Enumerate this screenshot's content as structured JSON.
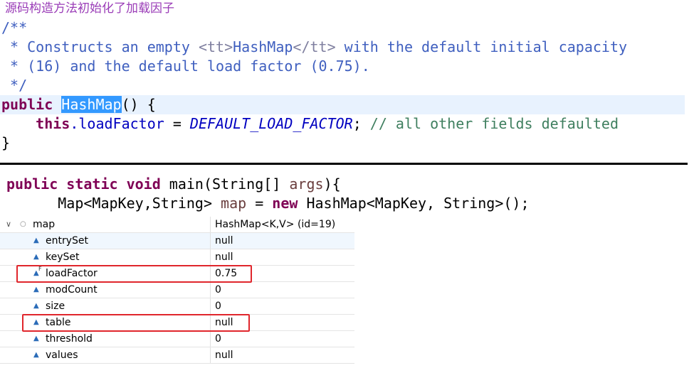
{
  "caption": "源码构造方法初始化了加载因子",
  "javadoc": {
    "open": "/**",
    "line1_prefix": " * Constructs an empty ",
    "line1_tag_open": "<tt>",
    "line1_class": "HashMap",
    "line1_tag_close": "</tt>",
    "line1_suffix": " with the default initial capacity",
    "line2": " * (16) and the default load factor (0.75).",
    "close": " */"
  },
  "constructor": {
    "modifier": "public",
    "name": "HashMap",
    "after_name": "() {",
    "body_indent": "    ",
    "this_kw": "this",
    "field": ".loadFactor",
    "assign": " = ",
    "constant": "DEFAULT_LOAD_FACTOR",
    "semicolon": ";",
    "comment": " // all other fields defaulted",
    "close_brace": "}"
  },
  "main": {
    "kw1": "public",
    "kw2": "static",
    "kw3": "void",
    "sig_mid": " main(String[] ",
    "param": "args",
    "sig_end": "){",
    "decl_indent": "      ",
    "decl_type": "Map<MapKey,String> ",
    "var": "map",
    "decl_eq": " = ",
    "new_kw": "new",
    "decl_rest": " HashMap<MapKey, String>();"
  },
  "variables": {
    "root": {
      "name": "map",
      "value": "HashMap<K,V>  (id=19)"
    },
    "fields": [
      {
        "name": "entrySet",
        "value": "null"
      },
      {
        "name": "keySet",
        "value": "null"
      },
      {
        "name": "loadFactor",
        "value": "0.75",
        "final_mark": "F"
      },
      {
        "name": "modCount",
        "value": "0"
      },
      {
        "name": "size",
        "value": "0"
      },
      {
        "name": "table",
        "value": "null"
      },
      {
        "name": "threshold",
        "value": "0"
      },
      {
        "name": "values",
        "value": "null"
      }
    ]
  },
  "colors": {
    "caption": "#9a3cb7",
    "javadoc": "#3f5fbf",
    "keyword": "#7f0055",
    "field": "#0000c0",
    "comment": "#3f7f5f",
    "selection": "#3399ff",
    "highlight_line": "#e8f2fe",
    "annotation_box": "#e0262c"
  },
  "icons": {
    "expand": "chevron-down-icon",
    "object": "object-instance-icon",
    "field": "field-triangle-icon"
  }
}
